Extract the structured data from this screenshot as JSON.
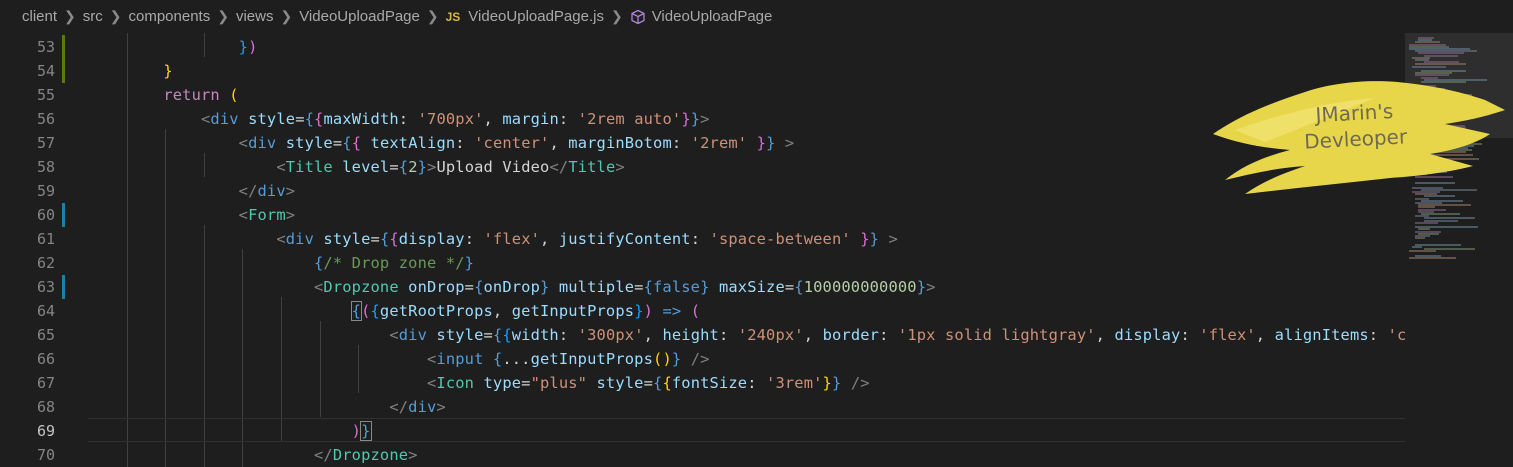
{
  "breadcrumb": {
    "items": [
      "client",
      "src",
      "components",
      "views",
      "VideoUploadPage",
      "VideoUploadPage.js",
      "VideoUploadPage"
    ],
    "file_badge": "JS",
    "separator": "›"
  },
  "editor": {
    "line_numbers": [
      "53",
      "54",
      "55",
      "56",
      "57",
      "58",
      "59",
      "60",
      "61",
      "62",
      "63",
      "64",
      "65",
      "66",
      "67",
      "68",
      "69",
      "70"
    ],
    "active_line": "69",
    "modified_lines": [
      "53",
      "54"
    ],
    "changed_lines": [
      "60",
      "63"
    ]
  },
  "watermark": {
    "line1": "JMarin's",
    "line2": "Devleoper"
  },
  "colors": {
    "background": "#1e1e1e",
    "keyword": "#c586c0",
    "tag": "#569cd6",
    "component": "#4ec9b0",
    "attribute": "#9cdcfe",
    "string": "#ce9178",
    "number": "#b5cea8",
    "comment": "#6a9955",
    "watermark_fill": "#e8d64a"
  }
}
